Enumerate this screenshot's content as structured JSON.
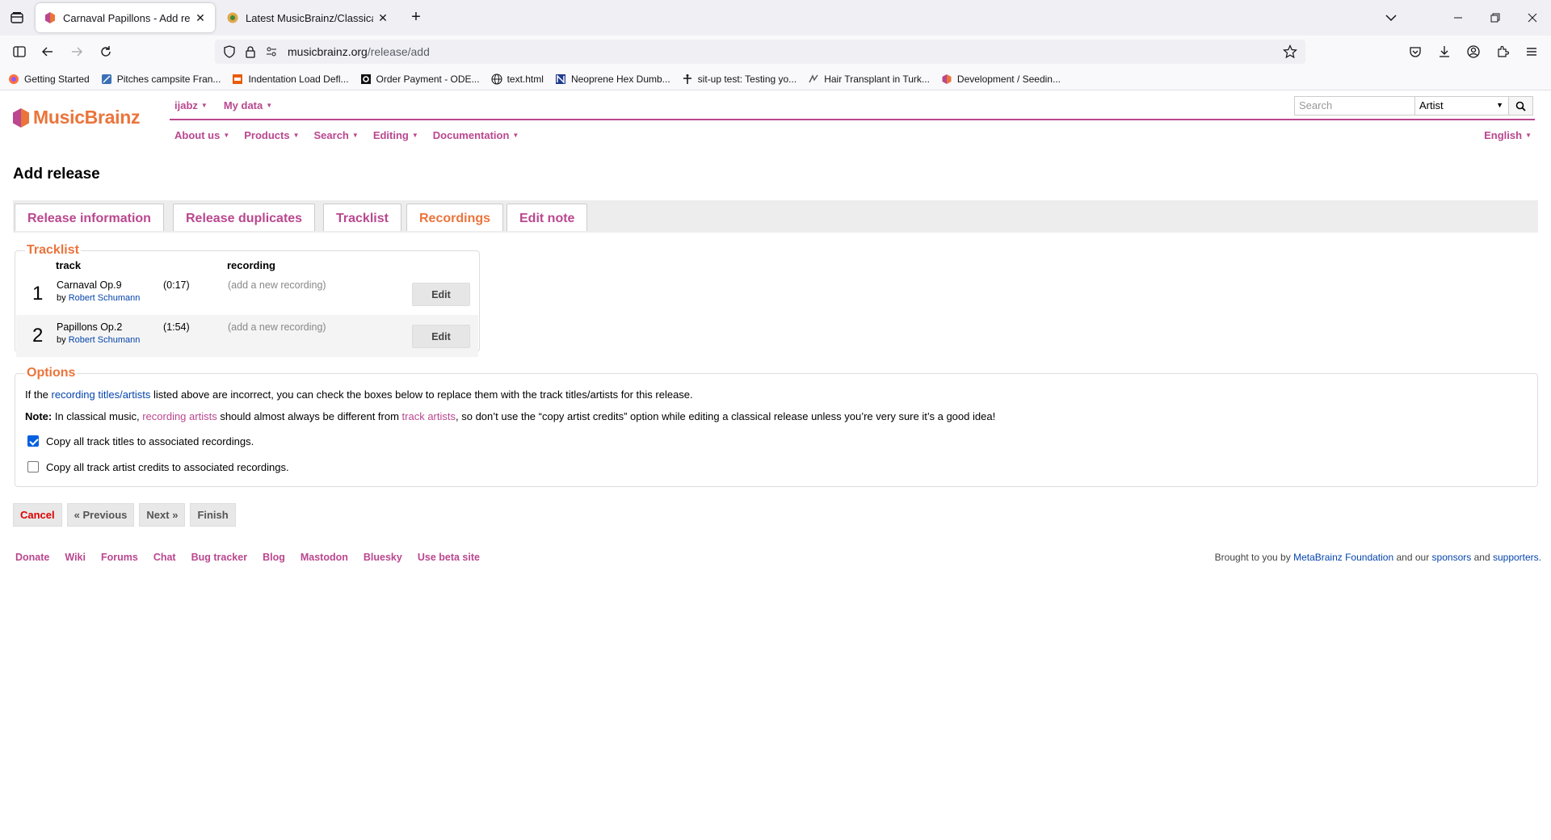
{
  "browser": {
    "tabs": [
      {
        "title": "Carnaval Papillons - Add release",
        "active": true
      },
      {
        "title": "Latest MusicBrainz/Classical top",
        "active": false
      }
    ],
    "url_host": "musicbrainz.org",
    "url_path": "/release/add",
    "bookmarks": [
      "Getting Started",
      "Pitches campsite Fran...",
      "Indentation Load Defl...",
      "Order Payment - ODE...",
      "text.html",
      "Neoprene Hex Dumb...",
      "sit-up test: Testing yo...",
      "Hair Transplant in Turk...",
      "Development / Seedin..."
    ]
  },
  "site": {
    "logo_text": "MusicBrainz",
    "user_menu": "ijabz",
    "my_data_menu": "My data",
    "search_placeholder": "Search",
    "search_type": "Artist",
    "nav": [
      "About us",
      "Products",
      "Search",
      "Editing",
      "Documentation"
    ],
    "language": "English",
    "brand_colors": {
      "purple": "#ba478f",
      "orange": "#eb743b"
    }
  },
  "page": {
    "title": "Add release",
    "tabs": [
      "Release information",
      "Release duplicates",
      "Tracklist",
      "Recordings",
      "Edit note"
    ],
    "current_tab": "Recordings"
  },
  "tracklist": {
    "legend": "Tracklist",
    "col_track": "track",
    "col_recording": "recording",
    "rows": [
      {
        "num": "1",
        "title": "Carnaval Op.9",
        "by": "by",
        "artist": "Robert Schumann",
        "length": "(0:17)",
        "recording": "(add a new recording)",
        "edit": "Edit"
      },
      {
        "num": "2",
        "title": "Papillons Op.2",
        "by": "by",
        "artist": "Robert Schumann",
        "length": "(1:54)",
        "recording": "(add a new recording)",
        "edit": "Edit"
      }
    ]
  },
  "options": {
    "legend": "Options",
    "intro_pre": "If the",
    "intro_link": "recording titles/artists",
    "intro_post": "listed above are incorrect, you can check the boxes below to replace them with the track titles/artists for this release.",
    "note_label": "Note:",
    "note_pre": "In classical music,",
    "note_link1": "recording artists",
    "note_mid": "should almost always be different from",
    "note_link2": "track artists",
    "note_post": ", so don’t use the “copy artist credits” option while editing a classical release unless you’re very sure it’s a good idea!",
    "copy_titles_label": "Copy all track titles to associated recordings.",
    "copy_titles_checked": true,
    "copy_artists_label": "Copy all track artist credits to associated recordings.",
    "copy_artists_checked": false
  },
  "wizard": {
    "cancel": "Cancel",
    "previous": "« Previous",
    "next": "Next »",
    "finish": "Finish"
  },
  "footer": {
    "links": [
      "Donate",
      "Wiki",
      "Forums",
      "Chat",
      "Bug tracker",
      "Blog",
      "Mastodon",
      "Bluesky",
      "Use beta site"
    ],
    "credit_pre": "Brought to you by",
    "credit_org": "MetaBrainz Foundation",
    "credit_mid": "and our",
    "credit_sponsors": "sponsors",
    "credit_and": "and",
    "credit_supporters": "supporters."
  }
}
